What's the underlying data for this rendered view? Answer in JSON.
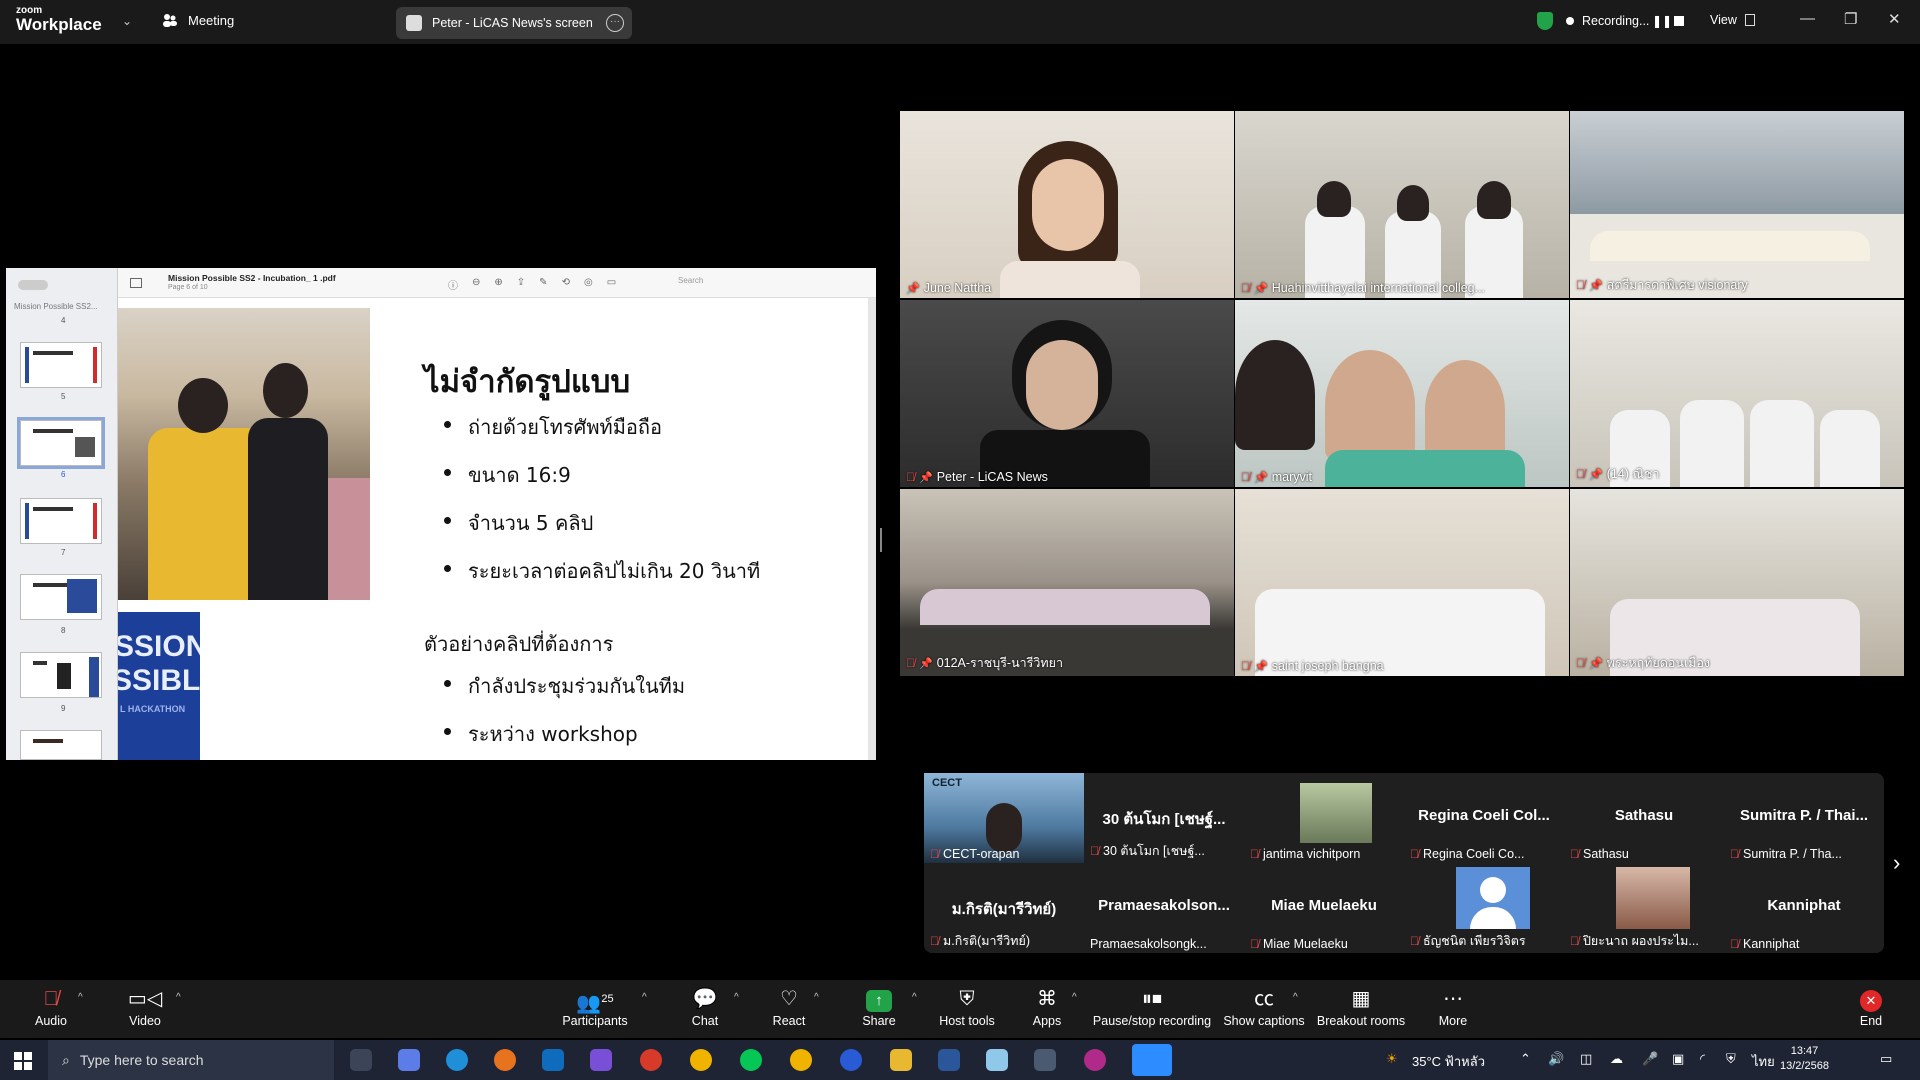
{
  "topbar": {
    "logo_small": "zoom",
    "logo_big": "Workplace",
    "meeting_label": "Meeting",
    "screen_share_label": "Peter - LiCAS News's screen",
    "recording_label": "Recording...",
    "view_label": "View"
  },
  "shared_screen": {
    "pdf_title": "Mission Possible SS2 - Incubation_ 1 .pdf",
    "pdf_page": "Page 6 of 10",
    "search_placeholder": "Search",
    "thumb_title": "Mission Possible SS2...",
    "thumb_numbers": [
      "4",
      "5",
      "6",
      "7",
      "8",
      "9"
    ],
    "slide": {
      "heading": "ไม่จำกัดรูปแบบ",
      "bullets": [
        "ถ่ายด้วยโทรศัพท์มือถือ",
        "ขนาด  16:9",
        "จำนวน 5 คลิป",
        "ระยะเวลาต่อคลิปไม่เกิน 20 วินาที"
      ],
      "subheading": "ตัวอย่างคลิปที่ต้องการ",
      "bullets2": [
        "กำลังประชุมร่วมกันในทีม",
        "ระหว่าง workshop"
      ],
      "photo2_text": [
        "SSION",
        "SSIBLE",
        "L HACKATHON"
      ]
    }
  },
  "video_grid": [
    {
      "name": "June Nattha",
      "muted": false,
      "active": true
    },
    {
      "name": "Huahinvitthayalai international colleg...",
      "muted": true
    },
    {
      "name": "สตรีมารดาพิเศษ visionary",
      "muted": true
    },
    {
      "name": "Peter - LiCAS News",
      "muted": true
    },
    {
      "name": "maryvit",
      "muted": true
    },
    {
      "name": "(14) ณิชา",
      "muted": true
    },
    {
      "name": "012A-ราชบุรี-นารีวิทยา",
      "muted": true
    },
    {
      "name": "saint joseph bangna",
      "muted": true
    },
    {
      "name": "พระหฤทัยดอนเมือง",
      "muted": true
    }
  ],
  "strip": [
    {
      "name": "CECT-orapan",
      "big": "",
      "video": true,
      "muted": true
    },
    {
      "name": "30 ต้นโมก [เชษฐ์...",
      "big": "30 ต้นโมก [เชษฐ์...",
      "video": false,
      "muted": true
    },
    {
      "name": "jantima vichitporn",
      "big": "",
      "video": true,
      "muted": true
    },
    {
      "name": "Regina Coeli Co...",
      "big": "Regina Coeli Col...",
      "video": false,
      "muted": true
    },
    {
      "name": "Sathasu",
      "big": "Sathasu",
      "video": false,
      "muted": true
    },
    {
      "name": "Sumitra P. / Tha...",
      "big": "Sumitra P. / Thai...",
      "video": false,
      "muted": true
    },
    {
      "name": "ม.กิรติ(มารีวิทย์)",
      "big": "ม.กิรติ(มารีวิทย์)",
      "video": false,
      "muted": true
    },
    {
      "name": "Pramaesakolsongk...",
      "big": "Pramaesakolson...",
      "video": false,
      "muted": false
    },
    {
      "name": "Miae Muelaeku",
      "big": "Miae Muelaeku",
      "video": false,
      "muted": true
    },
    {
      "name": "ธัญชนิต เพียรวิจิตร",
      "big": "",
      "video": true,
      "muted": true
    },
    {
      "name": "ปิยะนาถ ผองประไม...",
      "big": "",
      "video": true,
      "muted": true
    },
    {
      "name": "Kanniphat",
      "big": "Kanniphat",
      "video": false,
      "muted": true
    }
  ],
  "toolbar": {
    "audio": "Audio",
    "video": "Video",
    "participants": "Participants",
    "participants_count": "25",
    "chat": "Chat",
    "react": "React",
    "share": "Share",
    "host_tools": "Host tools",
    "apps": "Apps",
    "pause_stop": "Pause/stop recording",
    "captions": "Show captions",
    "breakout": "Breakout rooms",
    "more": "More",
    "end": "End"
  },
  "taskbar": {
    "search_placeholder": "Type here to search",
    "weather": "35°C ฟ้าหลัว",
    "lang": "ไทย",
    "time": "13:47",
    "date": "13/2/2568"
  },
  "colors": {
    "active_speaker": "#39d36a",
    "muted": "#e34a4a",
    "share_green": "#22a34a",
    "end_red": "#e02828"
  }
}
